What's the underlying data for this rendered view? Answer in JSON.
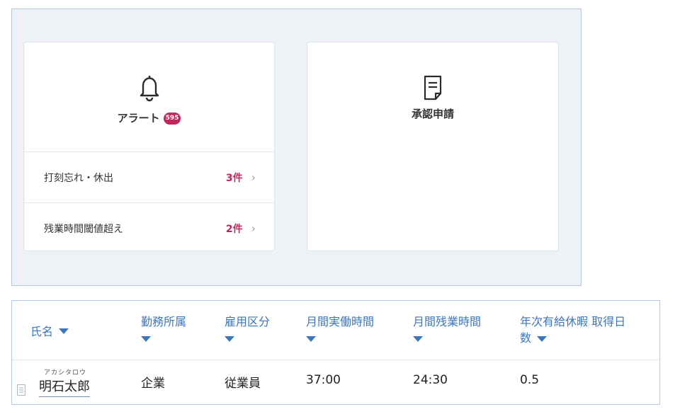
{
  "dashboard": {
    "alert_card": {
      "title": "アラート",
      "badge": "595",
      "icon": "bell-icon",
      "rows": [
        {
          "label": "打刻忘れ・休出",
          "count": "3件"
        },
        {
          "label": "残業時間閾値超え",
          "count": "2件"
        }
      ]
    },
    "approval_card": {
      "title": "承認申請",
      "icon": "document-icon"
    }
  },
  "table": {
    "headers": {
      "name": "氏名",
      "office": "勤務所属",
      "employment": "雇用区分",
      "work_hours": "月間実働時間",
      "overtime": "月間残業時間",
      "leave_a": "年次有給休暇 取得日",
      "leave_b": "数"
    },
    "rows": [
      {
        "furigana": "アカシタロウ",
        "name": "明石太郎",
        "office": "企業",
        "employment": "従業員",
        "work_hours": "37:00",
        "overtime": "24:30",
        "leave_days": "0.5"
      }
    ]
  },
  "colors": {
    "accent": "#3a76c2",
    "alert": "#c3255d",
    "panel_bg": "#eef1f5",
    "border": "#b6c9dc"
  }
}
